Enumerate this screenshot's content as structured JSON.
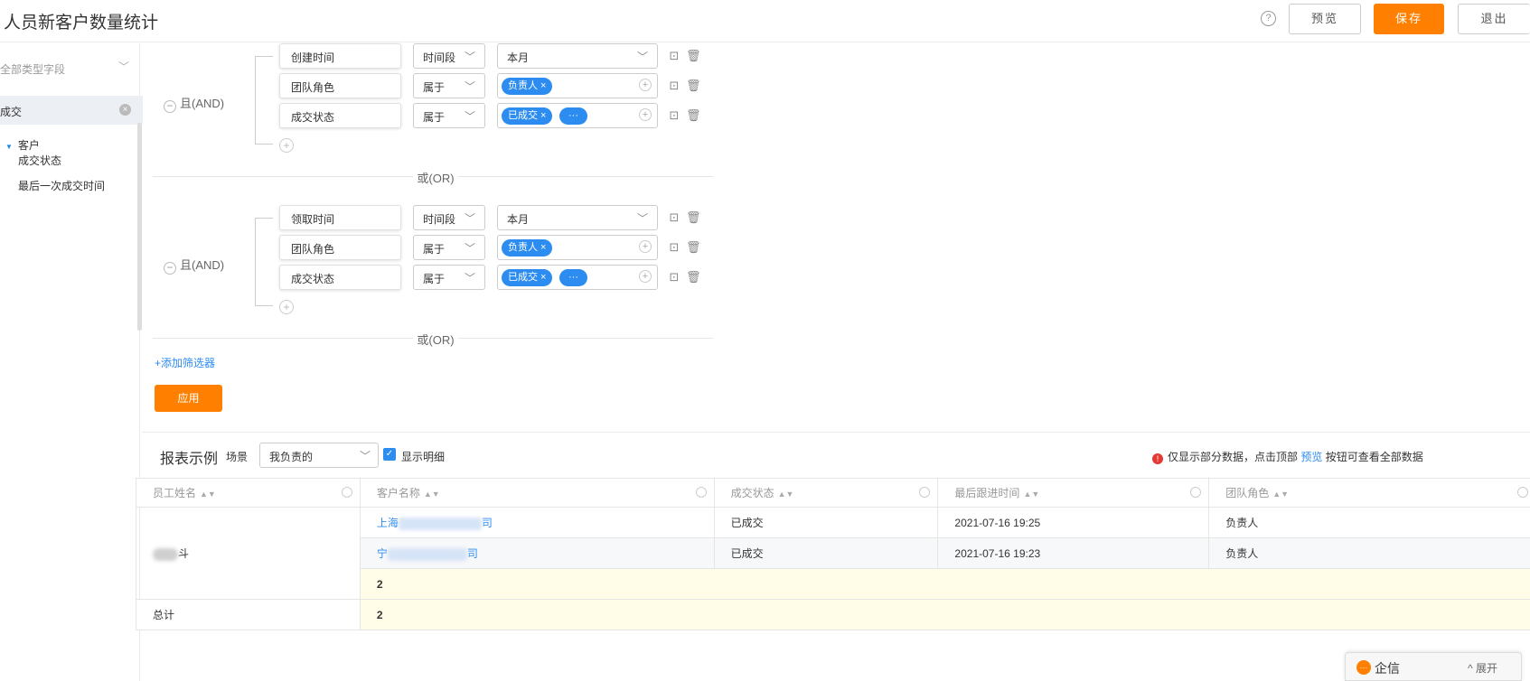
{
  "header": {
    "title": "人员新客户数量统计",
    "help_glyph": "?",
    "preview_label": "预览",
    "save_label": "保存",
    "exit_label": "退出"
  },
  "sidebar": {
    "field_type_select": "全部类型字段",
    "search_value": "成交",
    "tree": {
      "node_label": "客户",
      "children": [
        "成交状态",
        "最后一次成交时间"
      ]
    }
  },
  "filters": {
    "groups": [
      {
        "logic_label": "且(AND)",
        "conditions": [
          {
            "field": "创建时间",
            "operator": "时间段",
            "value": "本月",
            "tags": []
          },
          {
            "field": "团队角色",
            "operator": "属于",
            "value": "",
            "tags": [
              "负责人 ×"
            ]
          },
          {
            "field": "成交状态",
            "operator": "属于",
            "value": "",
            "tags": [
              "已成交 ×",
              "···"
            ]
          }
        ]
      },
      {
        "logic_label": "且(AND)",
        "conditions": [
          {
            "field": "领取时间",
            "operator": "时间段",
            "value": "本月",
            "tags": []
          },
          {
            "field": "团队角色",
            "operator": "属于",
            "value": "",
            "tags": [
              "负责人 ×"
            ]
          },
          {
            "field": "成交状态",
            "operator": "属于",
            "value": "",
            "tags": [
              "已成交 ×",
              "···"
            ]
          }
        ]
      }
    ],
    "or_label": "或(OR)",
    "add_filter_label": "+添加筛选器",
    "apply_label": "应用"
  },
  "report": {
    "title": "报表示例",
    "scene_label": "场景",
    "scene_value": "我负责的",
    "show_detail_label": "显示明细",
    "notice_prefix": "仅显示部分数据，点击顶部",
    "notice_link": "预览",
    "notice_suffix": "按钮可查看全部数据",
    "columns": [
      "员工姓名",
      "客户名称",
      "成交状态",
      "最后跟进时间",
      "团队角色"
    ],
    "rows": [
      {
        "customer_start": "上海",
        "customer_end": "司",
        "status": "已成交",
        "last_follow": "2021-07-16 19:25",
        "role": "负责人"
      },
      {
        "customer_start": "宁",
        "customer_end": "司",
        "status": "已成交",
        "last_follow": "2021-07-16 19:23",
        "role": "负责人"
      }
    ],
    "employee_suffix": "斗",
    "subtotal": "2",
    "total_label": "总计",
    "total_value": "2"
  },
  "chat": {
    "name": "企信",
    "expand_label": "^ 展开"
  }
}
